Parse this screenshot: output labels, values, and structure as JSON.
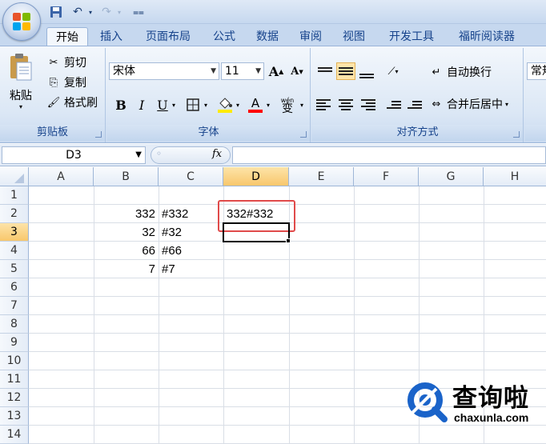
{
  "ribbon": {
    "tabs": [
      "开始",
      "插入",
      "页面布局",
      "公式",
      "数据",
      "审阅",
      "视图",
      "开发工具",
      "福昕阅读器"
    ],
    "clipboard": {
      "paste": "粘贴",
      "cut": "剪切",
      "copy": "复制",
      "format_painter": "格式刷",
      "label": "剪贴板"
    },
    "font": {
      "name": "宋体",
      "size": "11",
      "bold": "B",
      "italic": "I",
      "underline": "U",
      "grow": "A",
      "shrink": "A",
      "font_color": "A",
      "phonetic": "wén",
      "phonetic_char": "变",
      "label": "字体"
    },
    "alignment": {
      "wrap_text": "自动换行",
      "merge_center": "合并后居中",
      "label": "对齐方式"
    },
    "number": {
      "format": "常规"
    }
  },
  "formula_bar": {
    "name_box": "D3",
    "fx": "fx",
    "value": ""
  },
  "grid": {
    "columns": [
      "A",
      "B",
      "C",
      "D",
      "E",
      "F",
      "G",
      "H"
    ],
    "rows": [
      "1",
      "2",
      "3",
      "4",
      "5",
      "6",
      "7",
      "8",
      "9",
      "10",
      "11",
      "12",
      "13",
      "14"
    ],
    "cells": {
      "B2": "332",
      "C2": "#332",
      "D2": "332#332",
      "B3": "32",
      "C3": "#32",
      "B4": "66",
      "C4": "#66",
      "B5": "7",
      "C5": "#7"
    }
  },
  "watermark": {
    "brand": "查询啦",
    "url": "chaxunla.com"
  },
  "colors": {
    "ribbon_bg": "#dbe7f5",
    "tab_text": "#15428b",
    "selected_header": "#f8c76c",
    "highlight_box": "#e04a4a",
    "watermark_blue": "#1a63c9"
  }
}
